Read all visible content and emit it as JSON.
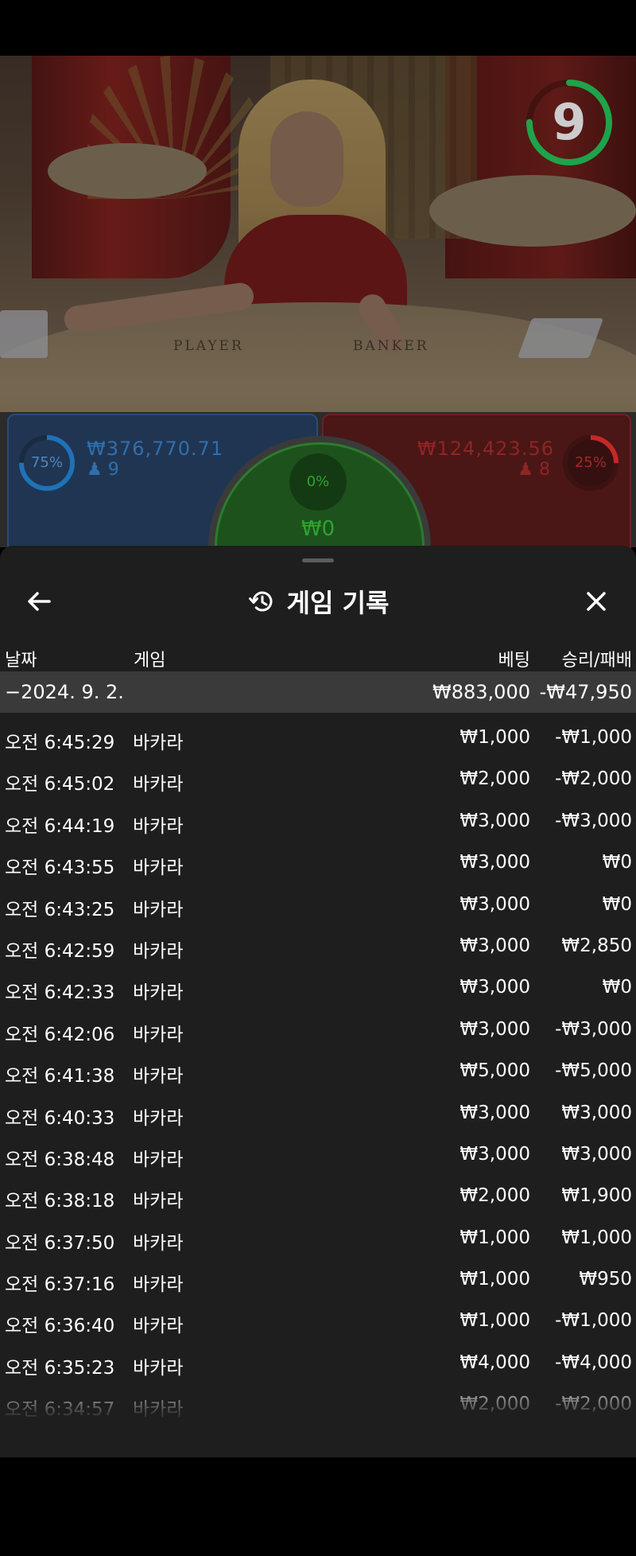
{
  "video": {
    "timer_value": "9",
    "timer_fraction": 0.75,
    "table_labels": {
      "player": "PLAYER",
      "banker": "BANKER"
    }
  },
  "betting": {
    "player": {
      "percent": "75%",
      "percent_value": 0.75,
      "amount": "₩376,770.71",
      "count": "9",
      "color": "#1f72b8"
    },
    "tie": {
      "percent": "0%",
      "amount": "₩0",
      "color": "#2fa32f"
    },
    "banker": {
      "percent": "25%",
      "percent_value": 0.25,
      "amount": "₩124,423.56",
      "count": "8",
      "color": "#c62828"
    }
  },
  "sheet": {
    "title": "게임 기록",
    "icons": {
      "back": "arrow-left-icon",
      "history": "history-icon",
      "close": "close-icon"
    },
    "columns": {
      "date": "날짜",
      "game": "게임",
      "bet": "베팅",
      "result": "승리/패배"
    },
    "date_group": {
      "label": "−2024. 9. 2.",
      "bet_total": "₩883,000",
      "result_total": "-₩47,950"
    },
    "rows": [
      {
        "time": "오전 6:45:29",
        "game": "바카라",
        "bet": "₩1,000",
        "result": "-₩1,000"
      },
      {
        "time": "오전 6:45:02",
        "game": "바카라",
        "bet": "₩2,000",
        "result": "-₩2,000"
      },
      {
        "time": "오전 6:44:19",
        "game": "바카라",
        "bet": "₩3,000",
        "result": "-₩3,000"
      },
      {
        "time": "오전 6:43:55",
        "game": "바카라",
        "bet": "₩3,000",
        "result": "₩0"
      },
      {
        "time": "오전 6:43:25",
        "game": "바카라",
        "bet": "₩3,000",
        "result": "₩0"
      },
      {
        "time": "오전 6:42:59",
        "game": "바카라",
        "bet": "₩3,000",
        "result": "₩2,850"
      },
      {
        "time": "오전 6:42:33",
        "game": "바카라",
        "bet": "₩3,000",
        "result": "₩0"
      },
      {
        "time": "오전 6:42:06",
        "game": "바카라",
        "bet": "₩3,000",
        "result": "-₩3,000"
      },
      {
        "time": "오전 6:41:38",
        "game": "바카라",
        "bet": "₩5,000",
        "result": "-₩5,000"
      },
      {
        "time": "오전 6:40:33",
        "game": "바카라",
        "bet": "₩3,000",
        "result": "₩3,000"
      },
      {
        "time": "오전 6:38:48",
        "game": "바카라",
        "bet": "₩3,000",
        "result": "₩3,000"
      },
      {
        "time": "오전 6:38:18",
        "game": "바카라",
        "bet": "₩2,000",
        "result": "₩1,900"
      },
      {
        "time": "오전 6:37:50",
        "game": "바카라",
        "bet": "₩1,000",
        "result": "₩1,000"
      },
      {
        "time": "오전 6:37:16",
        "game": "바카라",
        "bet": "₩1,000",
        "result": "₩950"
      },
      {
        "time": "오전 6:36:40",
        "game": "바카라",
        "bet": "₩1,000",
        "result": "-₩1,000"
      },
      {
        "time": "오전 6:35:23",
        "game": "바카라",
        "bet": "₩4,000",
        "result": "-₩4,000"
      },
      {
        "time": "오전 6:34:57",
        "game": "바카라",
        "bet": "₩2,000",
        "result": "-₩2,000"
      }
    ]
  }
}
